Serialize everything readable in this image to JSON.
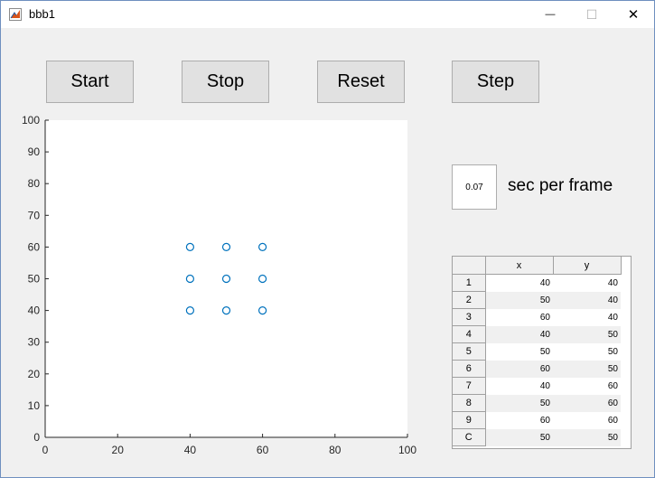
{
  "window": {
    "title": "bbb1",
    "minimize_glyph": "—",
    "maximize_glyph": "☐",
    "close_glyph": "✕"
  },
  "buttons": {
    "start": "Start",
    "stop": "Stop",
    "reset": "Reset",
    "step": "Step"
  },
  "frame_rate": {
    "value": "0.07",
    "label": "sec per frame"
  },
  "table": {
    "columns": [
      "x",
      "y"
    ],
    "rows": [
      {
        "label": "1",
        "x": "40",
        "y": "40"
      },
      {
        "label": "2",
        "x": "50",
        "y": "40"
      },
      {
        "label": "3",
        "x": "60",
        "y": "40"
      },
      {
        "label": "4",
        "x": "40",
        "y": "50"
      },
      {
        "label": "5",
        "x": "50",
        "y": "50"
      },
      {
        "label": "6",
        "x": "60",
        "y": "50"
      },
      {
        "label": "7",
        "x": "40",
        "y": "60"
      },
      {
        "label": "8",
        "x": "50",
        "y": "60"
      },
      {
        "label": "9",
        "x": "60",
        "y": "60"
      },
      {
        "label": "C",
        "x": "50",
        "y": "50"
      }
    ]
  },
  "chart_data": {
    "type": "scatter",
    "title": "",
    "xlabel": "",
    "ylabel": "",
    "xlim": [
      0,
      100
    ],
    "ylim": [
      0,
      100
    ],
    "xticks": [
      0,
      20,
      40,
      60,
      80,
      100
    ],
    "yticks": [
      0,
      10,
      20,
      30,
      40,
      50,
      60,
      70,
      80,
      90,
      100
    ],
    "grid": false,
    "marker": "open-circle",
    "marker_color": "#0072bd",
    "points": [
      {
        "x": 40,
        "y": 40
      },
      {
        "x": 50,
        "y": 40
      },
      {
        "x": 60,
        "y": 40
      },
      {
        "x": 40,
        "y": 50
      },
      {
        "x": 50,
        "y": 50
      },
      {
        "x": 60,
        "y": 50
      },
      {
        "x": 40,
        "y": 60
      },
      {
        "x": 50,
        "y": 60
      },
      {
        "x": 60,
        "y": 60
      }
    ]
  }
}
